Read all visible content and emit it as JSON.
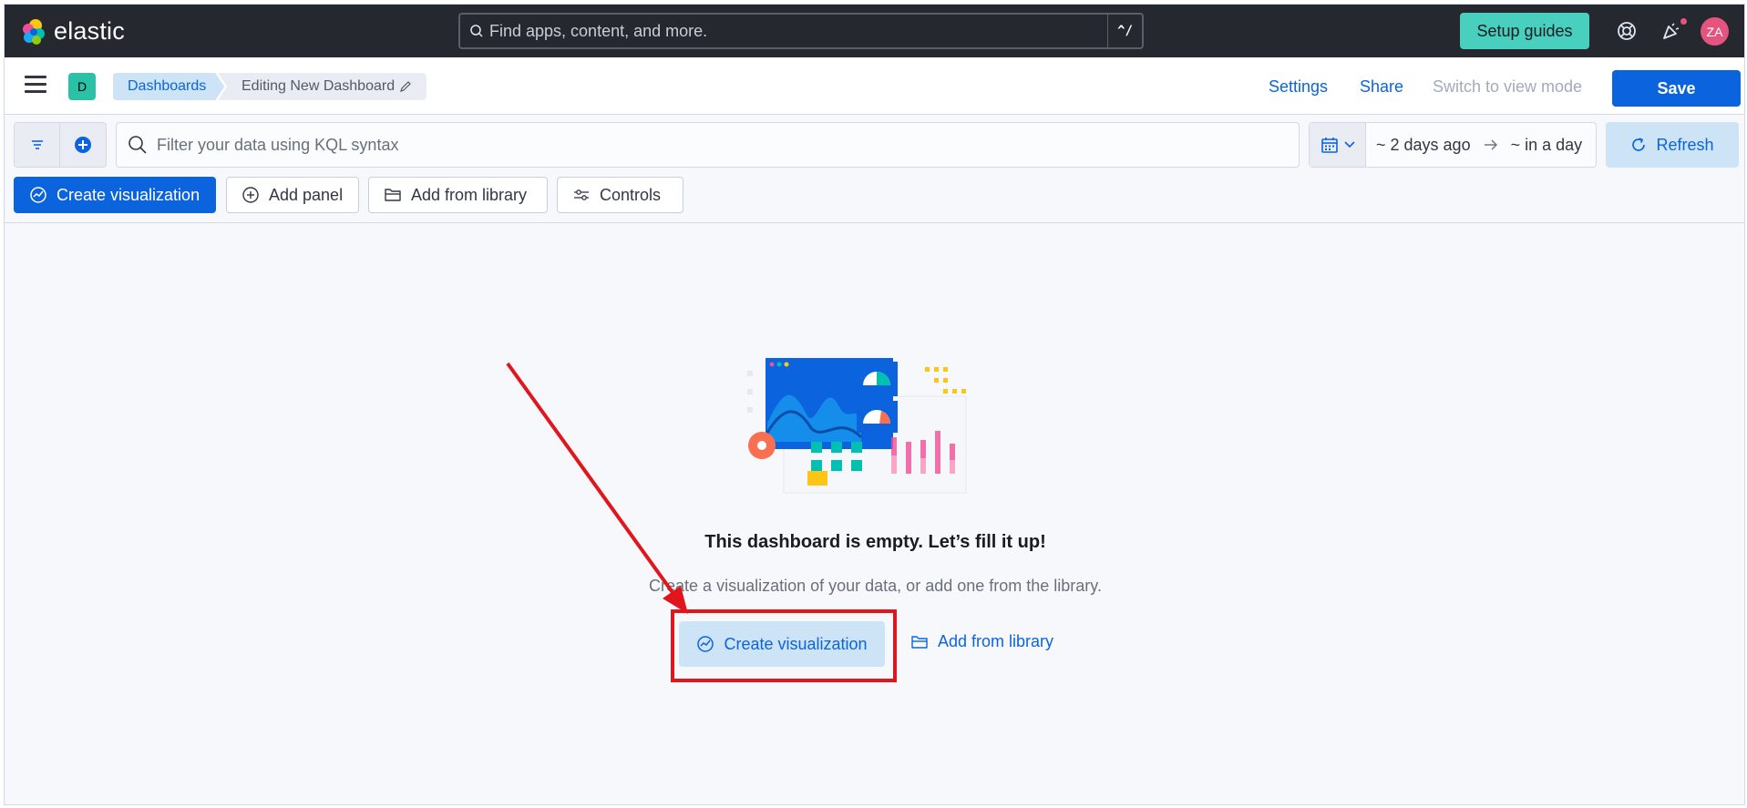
{
  "header": {
    "logo_text": "elastic",
    "search_placeholder": "Find apps, content, and more.",
    "search_shortcut": "^/",
    "setup_guides_label": "Setup guides",
    "avatar_initials": "ZA",
    "icons": [
      "help-icon",
      "news-feed-icon"
    ]
  },
  "navbar": {
    "space_initial": "D",
    "breadcrumbs": [
      "Dashboards",
      "Editing New Dashboard"
    ],
    "settings_label": "Settings",
    "share_label": "Share",
    "switch_mode_label": "Switch to view mode",
    "save_label": "Save"
  },
  "query_bar": {
    "kql_placeholder": "Filter your data using KQL syntax",
    "date_start": "~ 2 days ago",
    "date_end": "~ in a day",
    "refresh_label": "Refresh"
  },
  "toolbar": {
    "create_visualization_label": "Create visualization",
    "add_panel_label": "Add panel",
    "add_from_library_label": "Add from library",
    "controls_label": "Controls"
  },
  "empty_state": {
    "title": "This dashboard is empty. Let’s fill it up!",
    "subtitle": "Create a visualization of your data, or add one from the library.",
    "create_visualization_label": "Create visualization",
    "add_from_library_label": "Add from library"
  },
  "colors": {
    "header_bg": "#25282f",
    "primary": "#0b64dd",
    "setup_guides": "#48cfbe",
    "highlight_annotation": "#e0161c",
    "avatar": "#e5547e"
  }
}
